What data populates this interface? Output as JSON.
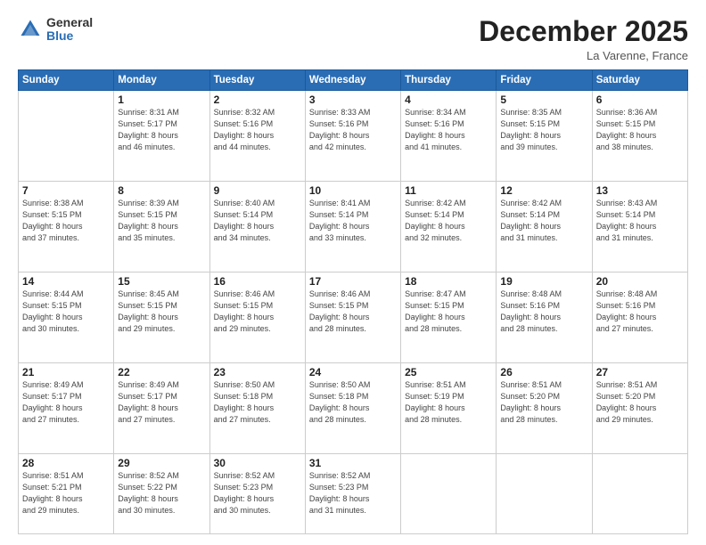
{
  "logo": {
    "general": "General",
    "blue": "Blue"
  },
  "header": {
    "month": "December 2025",
    "location": "La Varenne, France"
  },
  "weekdays": [
    "Sunday",
    "Monday",
    "Tuesday",
    "Wednesday",
    "Thursday",
    "Friday",
    "Saturday"
  ],
  "weeks": [
    [
      {
        "day": "",
        "info": ""
      },
      {
        "day": "1",
        "info": "Sunrise: 8:31 AM\nSunset: 5:17 PM\nDaylight: 8 hours\nand 46 minutes."
      },
      {
        "day": "2",
        "info": "Sunrise: 8:32 AM\nSunset: 5:16 PM\nDaylight: 8 hours\nand 44 minutes."
      },
      {
        "day": "3",
        "info": "Sunrise: 8:33 AM\nSunset: 5:16 PM\nDaylight: 8 hours\nand 42 minutes."
      },
      {
        "day": "4",
        "info": "Sunrise: 8:34 AM\nSunset: 5:16 PM\nDaylight: 8 hours\nand 41 minutes."
      },
      {
        "day": "5",
        "info": "Sunrise: 8:35 AM\nSunset: 5:15 PM\nDaylight: 8 hours\nand 39 minutes."
      },
      {
        "day": "6",
        "info": "Sunrise: 8:36 AM\nSunset: 5:15 PM\nDaylight: 8 hours\nand 38 minutes."
      }
    ],
    [
      {
        "day": "7",
        "info": "Sunrise: 8:38 AM\nSunset: 5:15 PM\nDaylight: 8 hours\nand 37 minutes."
      },
      {
        "day": "8",
        "info": "Sunrise: 8:39 AM\nSunset: 5:15 PM\nDaylight: 8 hours\nand 35 minutes."
      },
      {
        "day": "9",
        "info": "Sunrise: 8:40 AM\nSunset: 5:14 PM\nDaylight: 8 hours\nand 34 minutes."
      },
      {
        "day": "10",
        "info": "Sunrise: 8:41 AM\nSunset: 5:14 PM\nDaylight: 8 hours\nand 33 minutes."
      },
      {
        "day": "11",
        "info": "Sunrise: 8:42 AM\nSunset: 5:14 PM\nDaylight: 8 hours\nand 32 minutes."
      },
      {
        "day": "12",
        "info": "Sunrise: 8:42 AM\nSunset: 5:14 PM\nDaylight: 8 hours\nand 31 minutes."
      },
      {
        "day": "13",
        "info": "Sunrise: 8:43 AM\nSunset: 5:14 PM\nDaylight: 8 hours\nand 31 minutes."
      }
    ],
    [
      {
        "day": "14",
        "info": "Sunrise: 8:44 AM\nSunset: 5:15 PM\nDaylight: 8 hours\nand 30 minutes."
      },
      {
        "day": "15",
        "info": "Sunrise: 8:45 AM\nSunset: 5:15 PM\nDaylight: 8 hours\nand 29 minutes."
      },
      {
        "day": "16",
        "info": "Sunrise: 8:46 AM\nSunset: 5:15 PM\nDaylight: 8 hours\nand 29 minutes."
      },
      {
        "day": "17",
        "info": "Sunrise: 8:46 AM\nSunset: 5:15 PM\nDaylight: 8 hours\nand 28 minutes."
      },
      {
        "day": "18",
        "info": "Sunrise: 8:47 AM\nSunset: 5:15 PM\nDaylight: 8 hours\nand 28 minutes."
      },
      {
        "day": "19",
        "info": "Sunrise: 8:48 AM\nSunset: 5:16 PM\nDaylight: 8 hours\nand 28 minutes."
      },
      {
        "day": "20",
        "info": "Sunrise: 8:48 AM\nSunset: 5:16 PM\nDaylight: 8 hours\nand 27 minutes."
      }
    ],
    [
      {
        "day": "21",
        "info": "Sunrise: 8:49 AM\nSunset: 5:17 PM\nDaylight: 8 hours\nand 27 minutes."
      },
      {
        "day": "22",
        "info": "Sunrise: 8:49 AM\nSunset: 5:17 PM\nDaylight: 8 hours\nand 27 minutes."
      },
      {
        "day": "23",
        "info": "Sunrise: 8:50 AM\nSunset: 5:18 PM\nDaylight: 8 hours\nand 27 minutes."
      },
      {
        "day": "24",
        "info": "Sunrise: 8:50 AM\nSunset: 5:18 PM\nDaylight: 8 hours\nand 28 minutes."
      },
      {
        "day": "25",
        "info": "Sunrise: 8:51 AM\nSunset: 5:19 PM\nDaylight: 8 hours\nand 28 minutes."
      },
      {
        "day": "26",
        "info": "Sunrise: 8:51 AM\nSunset: 5:20 PM\nDaylight: 8 hours\nand 28 minutes."
      },
      {
        "day": "27",
        "info": "Sunrise: 8:51 AM\nSunset: 5:20 PM\nDaylight: 8 hours\nand 29 minutes."
      }
    ],
    [
      {
        "day": "28",
        "info": "Sunrise: 8:51 AM\nSunset: 5:21 PM\nDaylight: 8 hours\nand 29 minutes."
      },
      {
        "day": "29",
        "info": "Sunrise: 8:52 AM\nSunset: 5:22 PM\nDaylight: 8 hours\nand 30 minutes."
      },
      {
        "day": "30",
        "info": "Sunrise: 8:52 AM\nSunset: 5:23 PM\nDaylight: 8 hours\nand 30 minutes."
      },
      {
        "day": "31",
        "info": "Sunrise: 8:52 AM\nSunset: 5:23 PM\nDaylight: 8 hours\nand 31 minutes."
      },
      {
        "day": "",
        "info": ""
      },
      {
        "day": "",
        "info": ""
      },
      {
        "day": "",
        "info": ""
      }
    ]
  ]
}
